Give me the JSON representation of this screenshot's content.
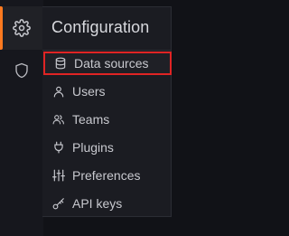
{
  "menu": {
    "title": "Configuration",
    "items": [
      {
        "label": "Data sources",
        "icon": "database-icon",
        "selected": true
      },
      {
        "label": "Users",
        "icon": "user-icon"
      },
      {
        "label": "Teams",
        "icon": "users-icon"
      },
      {
        "label": "Plugins",
        "icon": "plug-icon"
      },
      {
        "label": "Preferences",
        "icon": "sliders-icon"
      },
      {
        "label": "API keys",
        "icon": "key-icon"
      }
    ]
  },
  "rail": {
    "items": [
      {
        "icon": "gear-icon",
        "active": true
      },
      {
        "icon": "shield-icon",
        "active": false
      }
    ]
  },
  "colors": {
    "background": "#111217",
    "menu_background": "#1b1c22",
    "active_accent": "#ff7a1f",
    "highlight_border": "#e02424",
    "text": "#c8c9cf"
  }
}
